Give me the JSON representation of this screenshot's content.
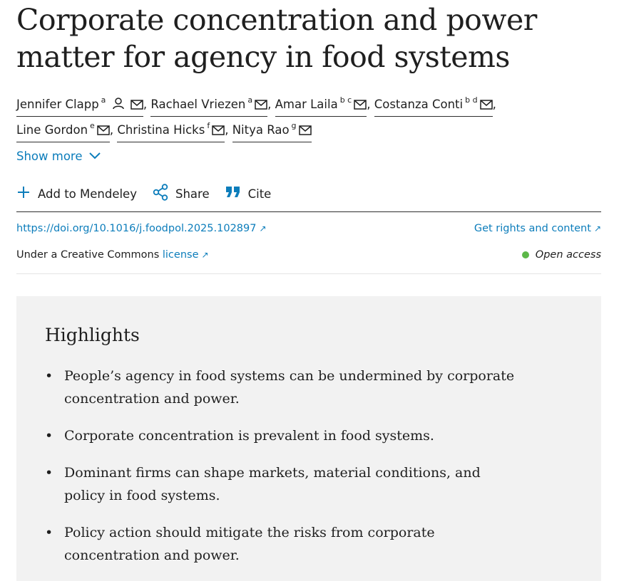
{
  "article": {
    "title": "Corporate concentration and power matter for agency in food systems"
  },
  "authors": [
    {
      "name": "Jennifer Clapp",
      "aff": "a",
      "icons": [
        "person-icon",
        "envelope-icon"
      ],
      "sep": ","
    },
    {
      "name": "Rachael Vriezen",
      "aff": "a",
      "icons": [
        "envelope-icon"
      ],
      "sep": ","
    },
    {
      "name": "Amar Laila",
      "aff": "b c",
      "icons": [
        "envelope-icon"
      ],
      "sep": ","
    },
    {
      "name": "Costanza Conti",
      "aff": "b d",
      "icons": [
        "envelope-icon"
      ],
      "sep": ","
    },
    {
      "name": "Line Gordon",
      "aff": "e",
      "icons": [
        "envelope-icon"
      ],
      "sep": ","
    },
    {
      "name": "Christina Hicks",
      "aff": "f",
      "icons": [
        "envelope-icon"
      ],
      "sep": ","
    },
    {
      "name": "Nitya Rao",
      "aff": "g",
      "icons": [
        "envelope-icon"
      ],
      "sep": ""
    }
  ],
  "show_more": {
    "label": "Show more",
    "icon": "chevron-down-icon"
  },
  "actions": {
    "mendeley": {
      "label": "Add to Mendeley",
      "icon": "plus-icon"
    },
    "share": {
      "label": "Share",
      "icon": "share-icon"
    },
    "cite": {
      "label": "Cite",
      "icon": "quote-icon"
    }
  },
  "links": {
    "doi": "https://doi.org/10.1016/j.foodpol.2025.102897",
    "rights": "Get rights and content",
    "license_prefix": "Under a Creative Commons",
    "license_link": "license",
    "open_access": "Open access",
    "external_icon": "↗"
  },
  "highlights": {
    "title": "Highlights",
    "items": [
      "People’s agency in food systems can be undermined by corporate concentration and power.",
      "Corporate concentration is prevalent in food systems.",
      "Dominant firms can shape markets, material conditions, and policy in food systems.",
      "Policy action should mitigate the risks from corporate concentration and power."
    ]
  },
  "colors": {
    "link": "#0c7dbb",
    "text": "#1f1f1f",
    "open_access_dot": "#5cb848",
    "highlights_bg": "#f2f2f2"
  }
}
